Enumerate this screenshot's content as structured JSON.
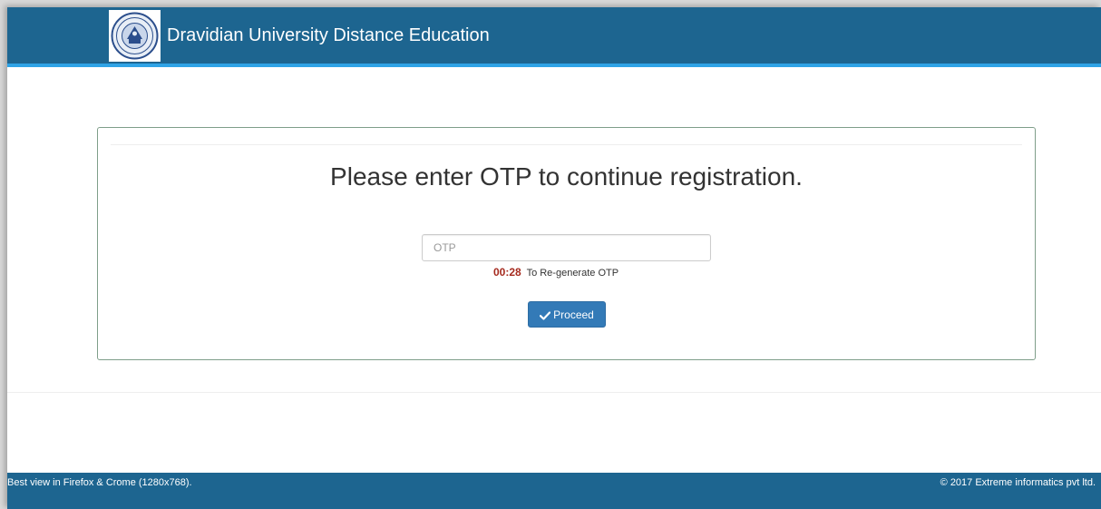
{
  "header": {
    "logo_icon": "university-seal-icon",
    "title": "Dravidian University Distance Education",
    "background": "#1d6590",
    "accent": "#2fa3e6"
  },
  "otp_form": {
    "heading": "Please enter OTP to continue registration.",
    "otp_placeholder": "OTP",
    "otp_value": "",
    "timer": "00:28",
    "regenerate_text": "To Re-generate OTP",
    "timer_color": "#a52a1e",
    "proceed_icon": "check-icon",
    "proceed_label": "Proceed",
    "button_color": "#337ab7"
  },
  "footer": {
    "browser_note": "Best view in Firefox & Crome (1280x768).",
    "copyright": "© 2017 Extreme informatics pvt ltd."
  }
}
